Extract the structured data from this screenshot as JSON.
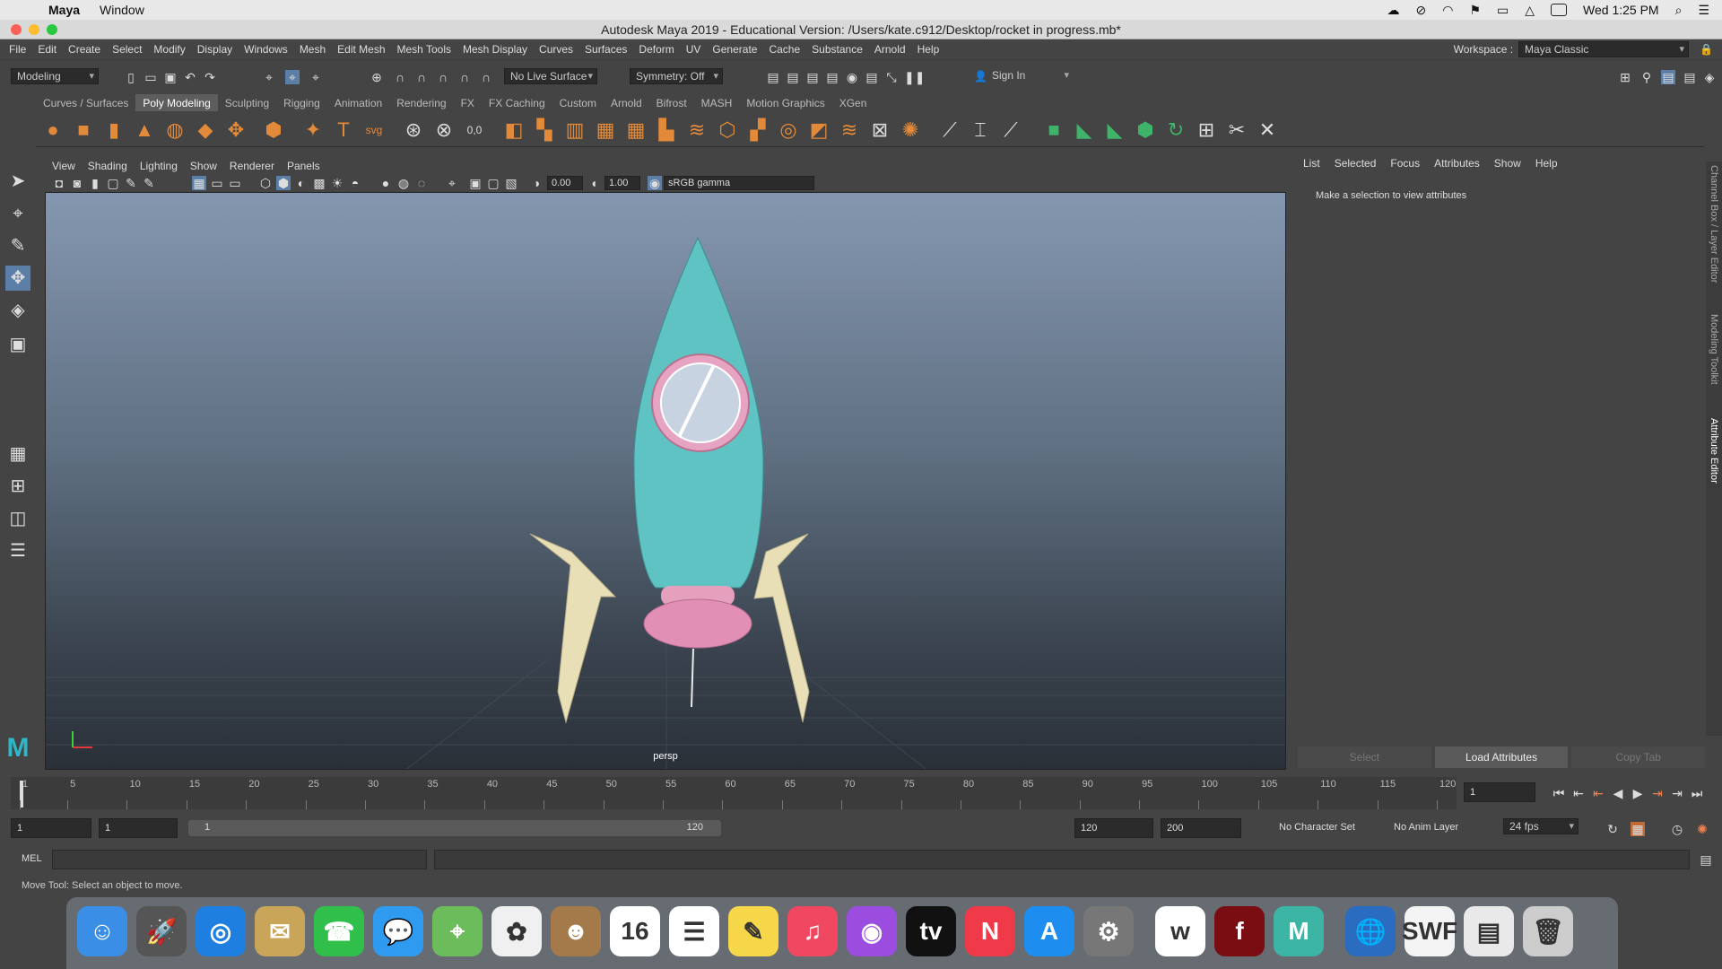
{
  "mac": {
    "app": "Maya",
    "menu": [
      "Window"
    ],
    "clock": "Wed 1:25 PM"
  },
  "title": "Autodesk Maya 2019 - Educational Version: /Users/kate.c912/Desktop/rocket in progress.mb*",
  "menu": [
    "File",
    "Edit",
    "Create",
    "Select",
    "Modify",
    "Display",
    "Windows",
    "Mesh",
    "Edit Mesh",
    "Mesh Tools",
    "Mesh Display",
    "Curves",
    "Surfaces",
    "Deform",
    "UV",
    "Generate",
    "Cache",
    "Substance",
    "Arnold",
    "Help"
  ],
  "workspace": {
    "label": "Workspace :",
    "value": "Maya Classic"
  },
  "status": {
    "mode": "Modeling",
    "live_surface": "No Live Surface",
    "symmetry": "Symmetry: Off",
    "sign_in": "Sign In"
  },
  "shelf_tabs": [
    "Curves / Surfaces",
    "Poly Modeling",
    "Sculpting",
    "Rigging",
    "Animation",
    "Rendering",
    "FX",
    "FX Caching",
    "Custom",
    "Arnold",
    "Bifrost",
    "MASH",
    "Motion Graphics",
    "XGen"
  ],
  "active_shelf": "Poly Modeling",
  "viewport_menu": [
    "View",
    "Shading",
    "Lighting",
    "Show",
    "Renderer",
    "Panels"
  ],
  "viewport": {
    "exposure": "0.00",
    "gamma": "1.00",
    "colorspace": "sRGB gamma",
    "camera": "persp"
  },
  "attr_editor": {
    "menu": [
      "List",
      "Selected",
      "Focus",
      "Attributes",
      "Show",
      "Help"
    ],
    "message": "Make a selection to view attributes",
    "buttons": [
      "Select",
      "Load Attributes",
      "Copy Tab"
    ]
  },
  "side_tabs": [
    "Channel Box / Layer Editor",
    "Modeling Toolkit",
    "Attribute Editor"
  ],
  "timeline": {
    "labels": [
      "1",
      "5",
      "10",
      "15",
      "20",
      "25",
      "30",
      "35",
      "40",
      "45",
      "50",
      "55",
      "60",
      "65",
      "70",
      "75",
      "80",
      "85",
      "90",
      "95",
      "100",
      "105",
      "110",
      "115",
      "120"
    ],
    "current": "1"
  },
  "range": {
    "start": "1",
    "anim_start": "1",
    "slider_start": "1",
    "slider_end": "120",
    "end": "120",
    "anim_end": "200",
    "char_set": "No Character Set",
    "anim_layer": "No Anim Layer",
    "fps": "24 fps"
  },
  "cmdline": {
    "label": "MEL"
  },
  "helpline": "Move Tool: Select an object to move.",
  "dock": [
    {
      "name": "finder-icon",
      "glyph": "☺",
      "color": "#3a8ee6"
    },
    {
      "name": "launchpad-icon",
      "glyph": "🚀",
      "color": "#555"
    },
    {
      "name": "safari-icon",
      "glyph": "◎",
      "color": "#1e7fe0"
    },
    {
      "name": "mail-icon",
      "glyph": "✉",
      "color": "#c9a55a"
    },
    {
      "name": "facetime-icon",
      "glyph": "☎",
      "color": "#2fbf4a"
    },
    {
      "name": "messages-icon",
      "glyph": "💬",
      "color": "#2e9bf0"
    },
    {
      "name": "maps-icon",
      "glyph": "⌖",
      "color": "#6bbd5b"
    },
    {
      "name": "photos-icon",
      "glyph": "✿",
      "color": "#f0f0f0"
    },
    {
      "name": "contacts-icon",
      "glyph": "☻",
      "color": "#a57a4b"
    },
    {
      "name": "calendar-icon",
      "glyph": "16",
      "color": "#ffffff"
    },
    {
      "name": "reminders-icon",
      "glyph": "☰",
      "color": "#ffffff"
    },
    {
      "name": "notes-icon",
      "glyph": "✎",
      "color": "#f7d74a"
    },
    {
      "name": "music-icon",
      "glyph": "♫",
      "color": "#f04860"
    },
    {
      "name": "podcasts-icon",
      "glyph": "◉",
      "color": "#9b4de0"
    },
    {
      "name": "tv-icon",
      "glyph": "tv",
      "color": "#111"
    },
    {
      "name": "news-icon",
      "glyph": "N",
      "color": "#f03a4a"
    },
    {
      "name": "appstore-icon",
      "glyph": "A",
      "color": "#1d8ef0"
    },
    {
      "name": "system-preferences-icon",
      "glyph": "⚙",
      "color": "#777"
    },
    {
      "name": "webex-icon",
      "glyph": "w",
      "color": "#ffffff"
    },
    {
      "name": "flash-icon",
      "glyph": "f",
      "color": "#7a0d12"
    },
    {
      "name": "maya-icon",
      "glyph": "M",
      "color": "#3db5a5"
    },
    {
      "name": "globe-icon",
      "glyph": "🌐",
      "color": "#2a6cc0"
    },
    {
      "name": "swf-icon",
      "glyph": "SWF",
      "color": "#f4f4f4"
    },
    {
      "name": "preview-icon",
      "glyph": "▤",
      "color": "#e9e9e9"
    },
    {
      "name": "trash-icon",
      "glyph": "🗑",
      "color": "#cccccc"
    }
  ]
}
